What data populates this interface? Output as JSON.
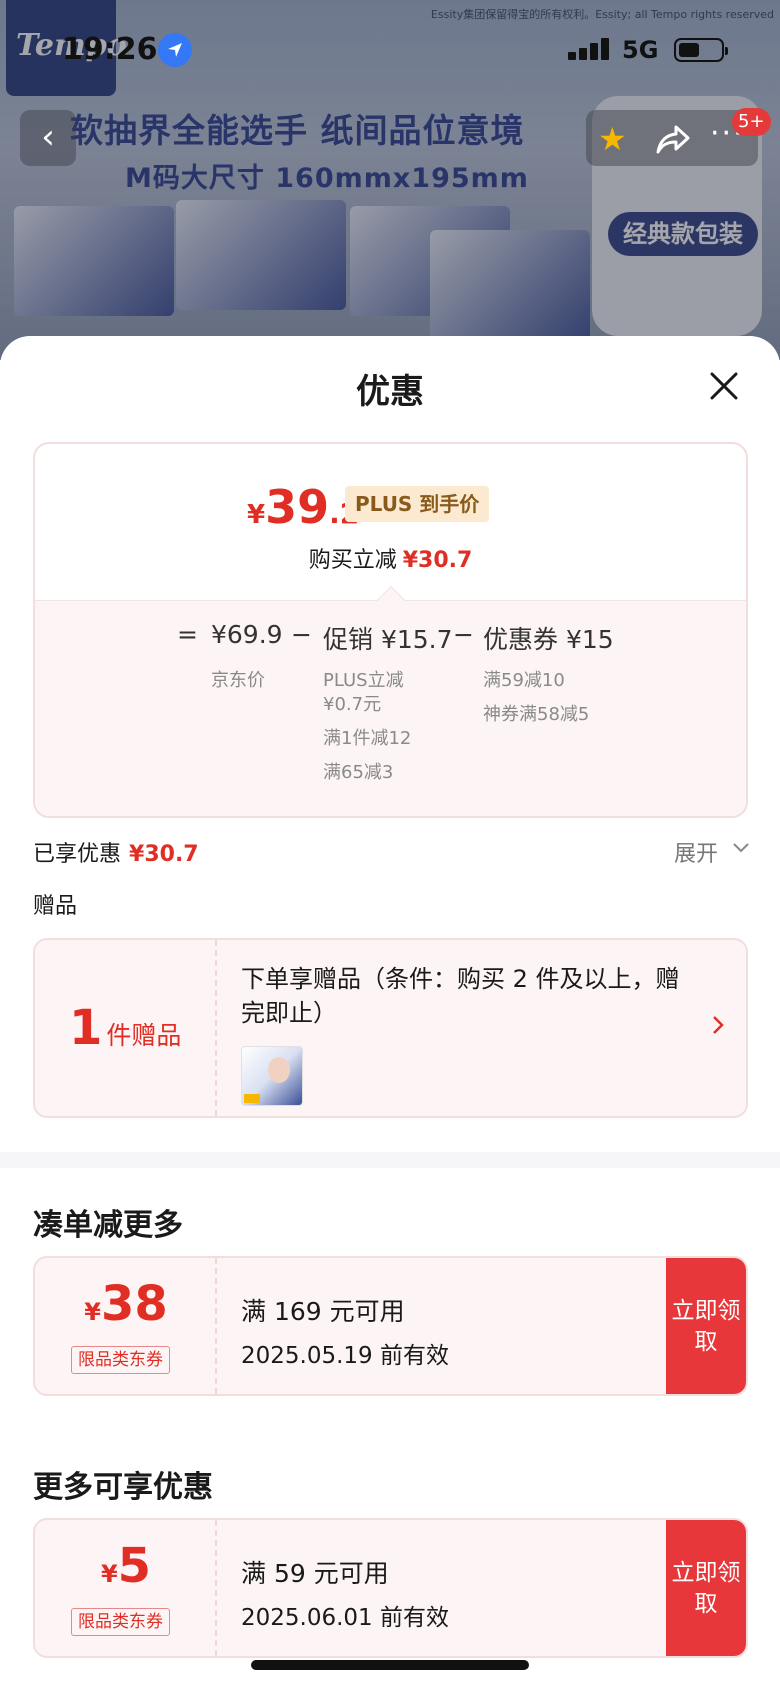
{
  "status_bar": {
    "time": "19:26",
    "network": "5G"
  },
  "background": {
    "brand": "Tempo",
    "copyright": "Essity集团保留得宝的所有权利。Essity; all Tempo rights reserved",
    "headline": "软抽界全能选手 纸间品位意境",
    "subline": "M码大尺寸 160mmx195mm",
    "side_label": "经典款包装"
  },
  "nav": {
    "back_icon": "chevron-left-icon",
    "more_badge": "5+"
  },
  "sheet": {
    "title": "优惠",
    "close_icon": "close-icon"
  },
  "price": {
    "symbol": "¥",
    "integer": "39",
    "decimal": ".2",
    "plus_label": "PLUS 到手价",
    "reduce_label": "购买立减",
    "reduce_value": "¥30.7",
    "breakdown": {
      "equals": "=",
      "jd_price": "¥69.9",
      "jd_price_label": "京东价",
      "minus1": "−",
      "promo": "促销 ¥15.7",
      "promo_details": [
        "PLUS立减",
        "¥0.7元",
        "满1件减12",
        "满65减3"
      ],
      "minus2": "−",
      "coupon": "优惠券 ¥15",
      "coupon_details": [
        "满59减10",
        "神券满58减5"
      ]
    }
  },
  "enjoyed": {
    "label": "已享优惠",
    "value": "¥30.7",
    "expand": "展开"
  },
  "gift": {
    "section_label": "赠品",
    "count": "1",
    "count_unit": "件赠品",
    "description": "下单享赠品（条件：购买 2 件及以上，赠完即止）"
  },
  "more_savings": {
    "title": "凑单减更多",
    "coupon": {
      "symbol": "¥",
      "value": "38",
      "type": "限品类东券",
      "condition": "满 169 元可用",
      "valid": "2025.05.19 前有效",
      "button": "立即领取"
    }
  },
  "more_discounts": {
    "title": "更多可享优惠",
    "coupon": {
      "symbol": "¥",
      "value": "5",
      "type": "限品类东券",
      "condition": "满 59 元可用",
      "valid": "2025.06.01 前有效",
      "button": "立即领取"
    }
  },
  "colors": {
    "accent": "#e02e24",
    "button": "#e8373a",
    "card_bg": "#fdf5f5"
  }
}
